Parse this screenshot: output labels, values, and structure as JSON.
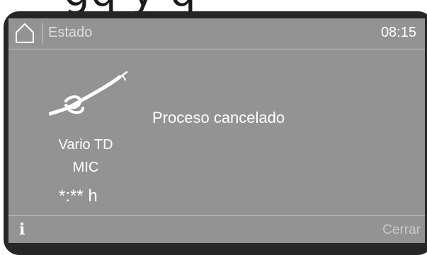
{
  "header": {
    "title": "Estado",
    "clock": "08:15",
    "home_icon": "home-icon"
  },
  "program": {
    "icon": "instrument-nozzle-icon",
    "name": "Vario TD",
    "mode": "MIC",
    "remaining_time": "*:** h"
  },
  "message": "Proceso cancelado",
  "footer": {
    "info_icon": "info-icon",
    "close_label": "Cerrar"
  },
  "colors": {
    "screen_bg": "#939393",
    "bezel": "#262626",
    "text": "#ffffff",
    "dim_text": "#c9c9c9"
  }
}
